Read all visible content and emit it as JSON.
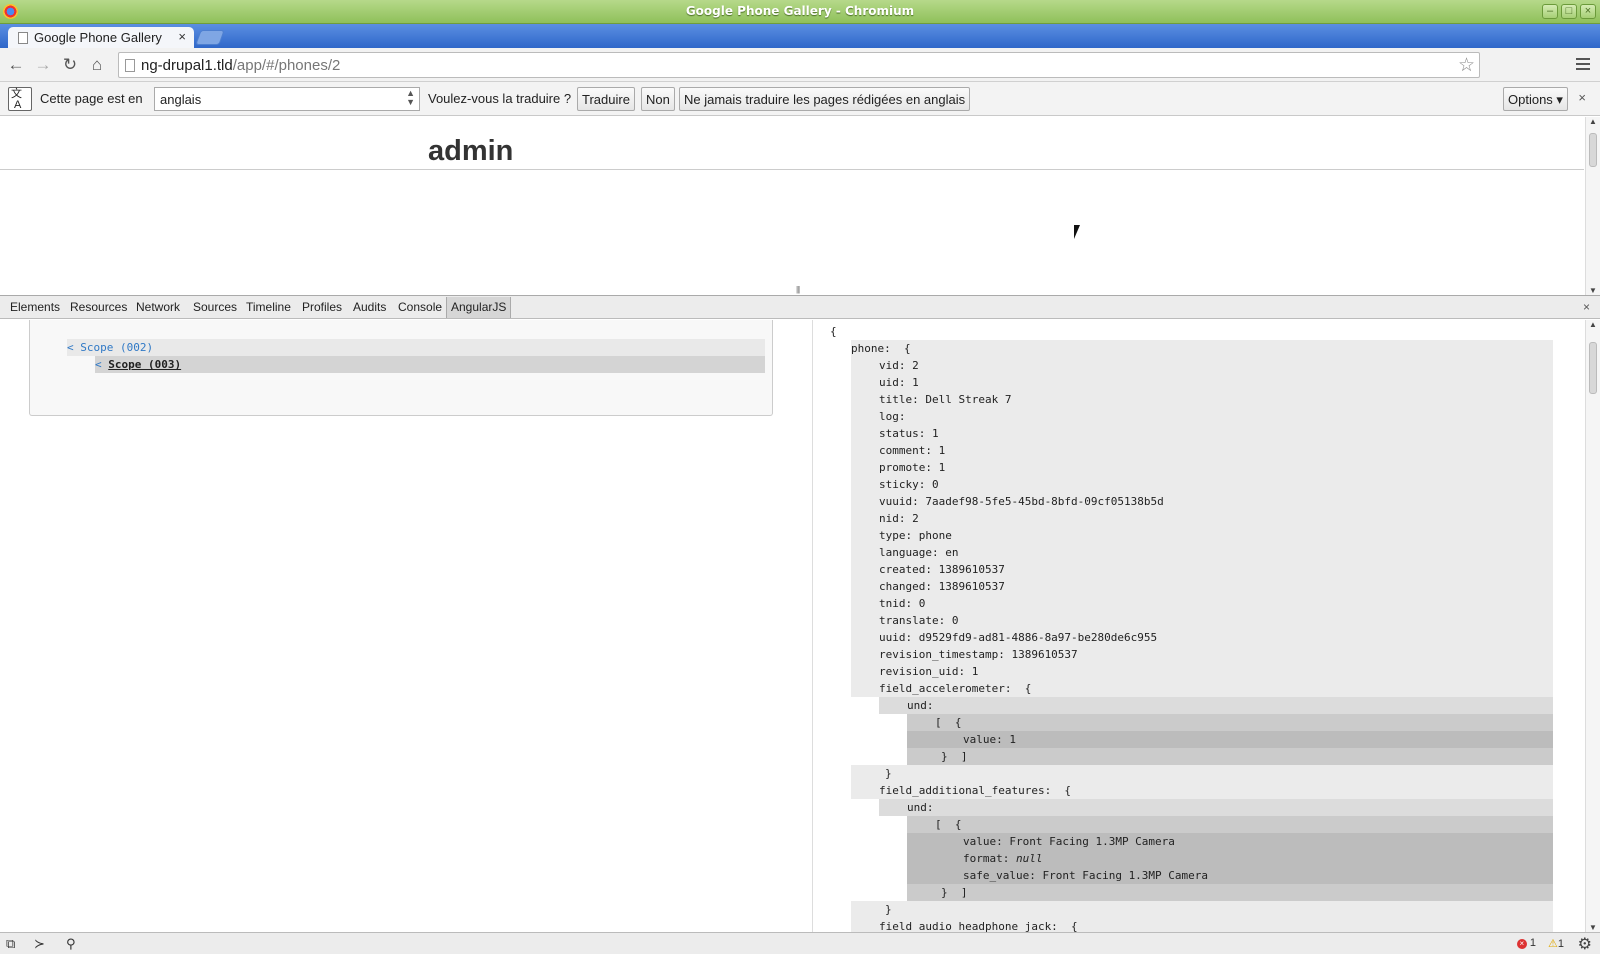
{
  "window": {
    "title": "Google Phone Gallery - Chromium"
  },
  "tabs": [
    {
      "label": "Google Phone Gallery",
      "close": "×"
    }
  ],
  "toolbar": {
    "url_host": "ng-drupal1.tld",
    "url_path": "/app/#/phones/2"
  },
  "translate": {
    "prefix": "Cette page est en",
    "language": "anglais",
    "question": "Voulez-vous la traduire ?",
    "translate_btn": "Traduire",
    "no_btn": "Non",
    "never_btn": "Ne jamais traduire les pages rédigées en anglais",
    "options_btn": "Options ▾",
    "close": "×"
  },
  "page": {
    "heading": "admin"
  },
  "devtools": {
    "tabs": [
      "Elements",
      "Resources",
      "Network",
      "Sources",
      "Timeline",
      "Profiles",
      "Audits",
      "Console",
      "AngularJS"
    ],
    "active_tab": "AngularJS",
    "close": "×",
    "scopes": [
      {
        "label": "< Scope (002)"
      },
      {
        "lt": "< ",
        "label": "Scope (003)"
      }
    ],
    "json_lines": [
      "{",
      "phone:  {",
      "vid: 2",
      "uid: 1",
      "title: Dell Streak 7",
      "log:",
      "status: 1",
      "comment: 1",
      "promote: 1",
      "sticky: 0",
      "vuuid: 7aadef98-5fe5-45bd-8bfd-09cf05138b5d",
      "nid: 2",
      "type: phone",
      "language: en",
      "created: 1389610537",
      "changed: 1389610537",
      "tnid: 0",
      "translate: 0",
      "uuid: d9529fd9-ad81-4886-8a97-be280de6c955",
      "revision_timestamp: 1389610537",
      "revision_uid: 1",
      "field_accelerometer:  {",
      "und:",
      "[  {",
      "value: 1",
      "}  ]",
      "}",
      "field_additional_features:  {",
      "und:",
      "[  {",
      "value: Front Facing 1.3MP Camera",
      "format: null",
      "safe_value: Front Facing 1.3MP Camera",
      "}  ]",
      "}",
      "field_audio_headphone_jack:  {"
    ],
    "errors": "1",
    "warnings": "1"
  }
}
